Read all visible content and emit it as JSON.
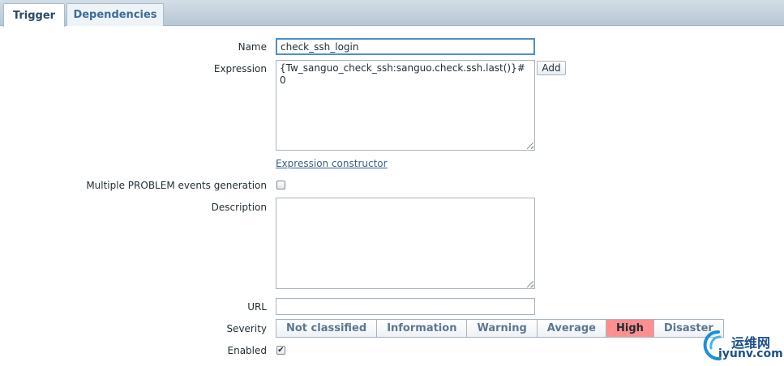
{
  "tabs": [
    {
      "label": "Trigger",
      "active": true
    },
    {
      "label": "Dependencies",
      "active": false
    }
  ],
  "form": {
    "name": {
      "label": "Name",
      "value": "check_ssh_login"
    },
    "expression": {
      "label": "Expression",
      "value": "{Tw_sanguo_check_ssh:sanguo.check.ssh.last()}#0",
      "add_button": "Add",
      "constructor_link": "Expression constructor"
    },
    "multiple_problem": {
      "label": "Multiple PROBLEM events generation",
      "checked": false
    },
    "description": {
      "label": "Description",
      "value": ""
    },
    "url": {
      "label": "URL",
      "value": ""
    },
    "severity": {
      "label": "Severity",
      "options": [
        "Not classified",
        "Information",
        "Warning",
        "Average",
        "High",
        "Disaster"
      ],
      "selected": "High",
      "selected_color": "#ff8f8f"
    },
    "enabled": {
      "label": "Enabled",
      "checked": true
    }
  },
  "watermark": {
    "cn": "运维网",
    "en": "iyunv.com"
  }
}
